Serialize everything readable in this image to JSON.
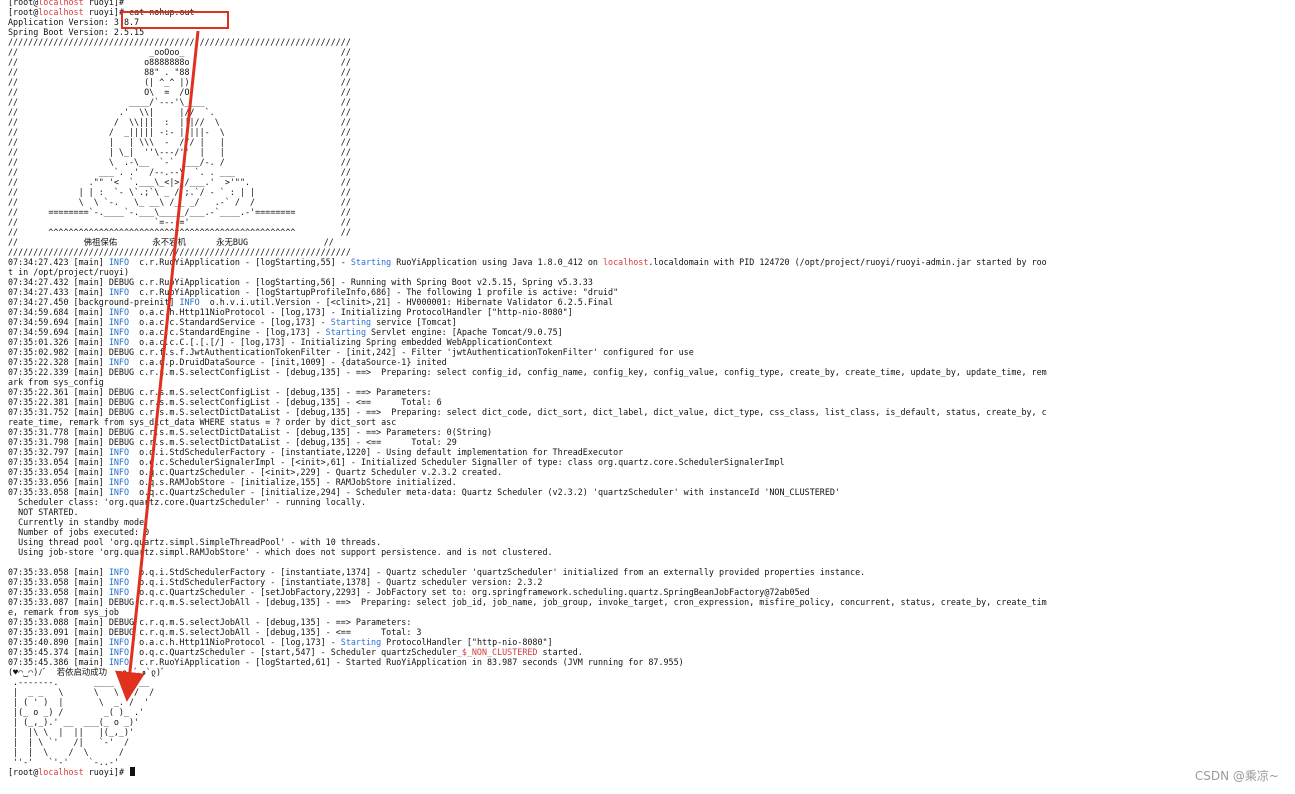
{
  "colors": {
    "background": "#ffffff",
    "text": "#111111",
    "hostname": "#d63c3c",
    "info_level": "#1f6fd1",
    "starting_keyword": "#2b6fd6",
    "annotation": "#e0301e",
    "watermark": "#9a9a9a"
  },
  "terminal": {
    "prompt_user": "[root@",
    "prompt_host": "localhost",
    "prompt_tail": " ruoyi]#",
    "command": " cat nohup.out",
    "lines": [
      "[root@localhost ruoyi]#",
      "[root@localhost ruoyi]# cat nohup.out",
      "Application Version: 3.8.7",
      "Spring Boot Version: 2.5.15",
      "////////////////////////////////////////////////////////////////////",
      "//                          _ooOoo_                               //",
      "//                         o8888888o                              //",
      "//                         88\" . \"88                              //",
      "//                         (| ^_^ |)                              //",
      "//                         O\\  =  /O                              //",
      "//                      ____/`---'\\____                           //",
      "//                    .'  \\\\|     |//  `.                         //",
      "//                   /  \\\\|||  :  |||//  \\                        //",
      "//                  /  _||||| -:- |||||-  \\                       //",
      "//                  |   | \\\\\\  -  /// |   |                       //",
      "//                  | \\_|  ''\\---/''  |   |                       //",
      "//                  \\  .-\\__  `-`  ___/-. /                       //",
      "//                ___`. .'  /--.--\\  `. . ___                     //",
      "//              .\"\" '<  `.___\\_<|>_/___.'  >'\"\".                  //",
      "//            | | :  `- \\`.;`\\ _ /`;.`/ - ` : | |                 //",
      "//            \\  \\ `-.   \\_ __\\ /__ _/   .-` /  /                 //",
      "//      ========`-.____`-.___\\_____/___.-`____.-'========         //",
      "//                           `=---='                              //",
      "//      ^^^^^^^^^^^^^^^^^^^^^^^^^^^^^^^^^^^^^^^^^^^^^^^^^         //",
      "//             佛祖保佑       永不宕机      永无BUG               //",
      "////////////////////////////////////////////////////////////////////",
      "07:34:27.423 [main] INFO  c.r.RuoYiApplication - [logStarting,55] - Starting RuoYiApplication using Java 1.8.0_412 on localhost.localdomain with PID 124720 (/opt/project/ruoyi/ruoyi-admin.jar started by roo",
      "t in /opt/project/ruoyi)",
      "07:34:27.432 [main] DEBUG c.r.RuoYiApplication - [logStarting,56] - Running with Spring Boot v2.5.15, Spring v5.3.33",
      "07:34:27.433 [main] INFO  c.r.RuoYiApplication - [logStartupProfileInfo,686] - The following 1 profile is active: \"druid\"",
      "07:34:27.450 [background-preinit] INFO  o.h.v.i.util.Version - [<clinit>,21] - HV000001: Hibernate Validator 6.2.5.Final",
      "07:34:59.684 [main] INFO  o.a.c.h.Http11NioProtocol - [log,173] - Initializing ProtocolHandler [\"http-nio-8080\"]",
      "07:34:59.694 [main] INFO  o.a.c.c.StandardService - [log,173] - Starting service [Tomcat]",
      "07:34:59.694 [main] INFO  o.a.c.c.StandardEngine - [log,173] - Starting Servlet engine: [Apache Tomcat/9.0.75]",
      "07:35:01.326 [main] INFO  o.a.c.c.C.[.[.[/] - [log,173] - Initializing Spring embedded WebApplicationContext",
      "07:35:02.982 [main] DEBUG c.r.f.s.f.JwtAuthenticationTokenFilter - [init,242] - Filter 'jwtAuthenticationTokenFilter' configured for use",
      "07:35:22.328 [main] INFO  c.a.d.p.DruidDataSource - [init,1009] - {dataSource-1} inited",
      "07:35:22.339 [main] DEBUG c.r.s.m.S.selectConfigList - [debug,135] - ==>  Preparing: select config_id, config_name, config_key, config_value, config_type, create_by, create_time, update_by, update_time, rem",
      "ark from sys_config",
      "07:35:22.361 [main] DEBUG c.r.s.m.S.selectConfigList - [debug,135] - ==> Parameters: ",
      "07:35:22.381 [main] DEBUG c.r.s.m.S.selectConfigList - [debug,135] - <==      Total: 6",
      "07:35:31.752 [main] DEBUG c.r.s.m.S.selectDictDataList - [debug,135] - ==>  Preparing: select dict_code, dict_sort, dict_label, dict_value, dict_type, css_class, list_class, is_default, status, create_by, c",
      "reate_time, remark from sys_dict_data WHERE status = ? order by dict_sort asc",
      "07:35:31.778 [main] DEBUG c.r.s.m.S.selectDictDataList - [debug,135] - ==> Parameters: 0(String)",
      "07:35:31.798 [main] DEBUG c.r.s.m.S.selectDictDataList - [debug,135] - <==      Total: 29",
      "07:35:32.797 [main] INFO  o.q.i.StdSchedulerFactory - [instantiate,1220] - Using default implementation for ThreadExecutor",
      "07:35:33.054 [main] INFO  o.q.c.SchedulerSignalerImpl - [<init>,61] - Initialized Scheduler Signaller of type: class org.quartz.core.SchedulerSignalerImpl",
      "07:35:33.054 [main] INFO  o.q.c.QuartzScheduler - [<init>,229] - Quartz Scheduler v.2.3.2 created.",
      "07:35:33.056 [main] INFO  o.q.s.RAMJobStore - [initialize,155] - RAMJobStore initialized.",
      "07:35:33.058 [main] INFO  o.q.c.QuartzScheduler - [initialize,294] - Scheduler meta-data: Quartz Scheduler (v2.3.2) 'quartzScheduler' with instanceId 'NON_CLUSTERED'",
      "  Scheduler class: 'org.quartz.core.QuartzScheduler' - running locally.",
      "  NOT STARTED.",
      "  Currently in standby mode.",
      "  Number of jobs executed: 0",
      "  Using thread pool 'org.quartz.simpl.SimpleThreadPool' - with 10 threads.",
      "  Using job-store 'org.quartz.simpl.RAMJobStore' - which does not support persistence. and is not clustered.",
      "",
      "07:35:33.058 [main] INFO  o.q.i.StdSchedulerFactory - [instantiate,1374] - Quartz scheduler 'quartzScheduler' initialized from an externally provided properties instance.",
      "07:35:33.058 [main] INFO  o.q.i.StdSchedulerFactory - [instantiate,1378] - Quartz scheduler version: 2.3.2",
      "07:35:33.058 [main] INFO  o.q.c.QuartzScheduler - [setJobFactory,2293] - JobFactory set to: org.springframework.scheduling.quartz.SpringBeanJobFactory@72ab05ed",
      "07:35:33.087 [main] DEBUG c.r.q.m.S.selectJobAll - [debug,135] - ==>  Preparing: select job_id, job_name, job_group, invoke_target, cron_expression, misfire_policy, concurrent, status, create_by, create_tim",
      "e, remark from sys_job",
      "07:35:33.088 [main] DEBUG c.r.q.m.S.selectJobAll - [debug,135] - ==> Parameters: ",
      "07:35:33.091 [main] DEBUG c.r.q.m.S.selectJobAll - [debug,135] - <==      Total: 3",
      "07:35:40.890 [main] INFO  o.a.c.h.Http11NioProtocol - [log,173] - Starting ProtocolHandler [\"http-nio-8080\"]",
      "07:35:45.374 [main] INFO  o.q.c.QuartzScheduler - [start,547] - Scheduler quartzScheduler_$_NON_CLUSTERED started.",
      "07:35:45.386 [main] INFO  c.r.RuoYiApplication - [logStarted,61] - Started RuoYiApplication in 83.987 seconds (JVM running for 87.955)",
      "(♥◠‿◠)ﾉﾞ  若依启动成功   ლ(´ڡ`ლ)ﾞ",
      " .-------.       ____     __",
      " |  _ _   \\      \\   \\   /  /",
      " | ( ' )  |       \\  _. /  '",
      " |(_ o _) /        _( )_ .'",
      " | (_,_).' __  ___(_ o _)'",
      " |  |\\ \\  |  ||   |(_,_)'",
      " |  | \\ `'   /|   `-'  /",
      " |  |  \\    /  \\      /",
      " ''-'   `'-'    `-..-'",
      "[root@localhost ruoyi]#"
    ]
  },
  "watermark": "CSDN @乘凉~"
}
